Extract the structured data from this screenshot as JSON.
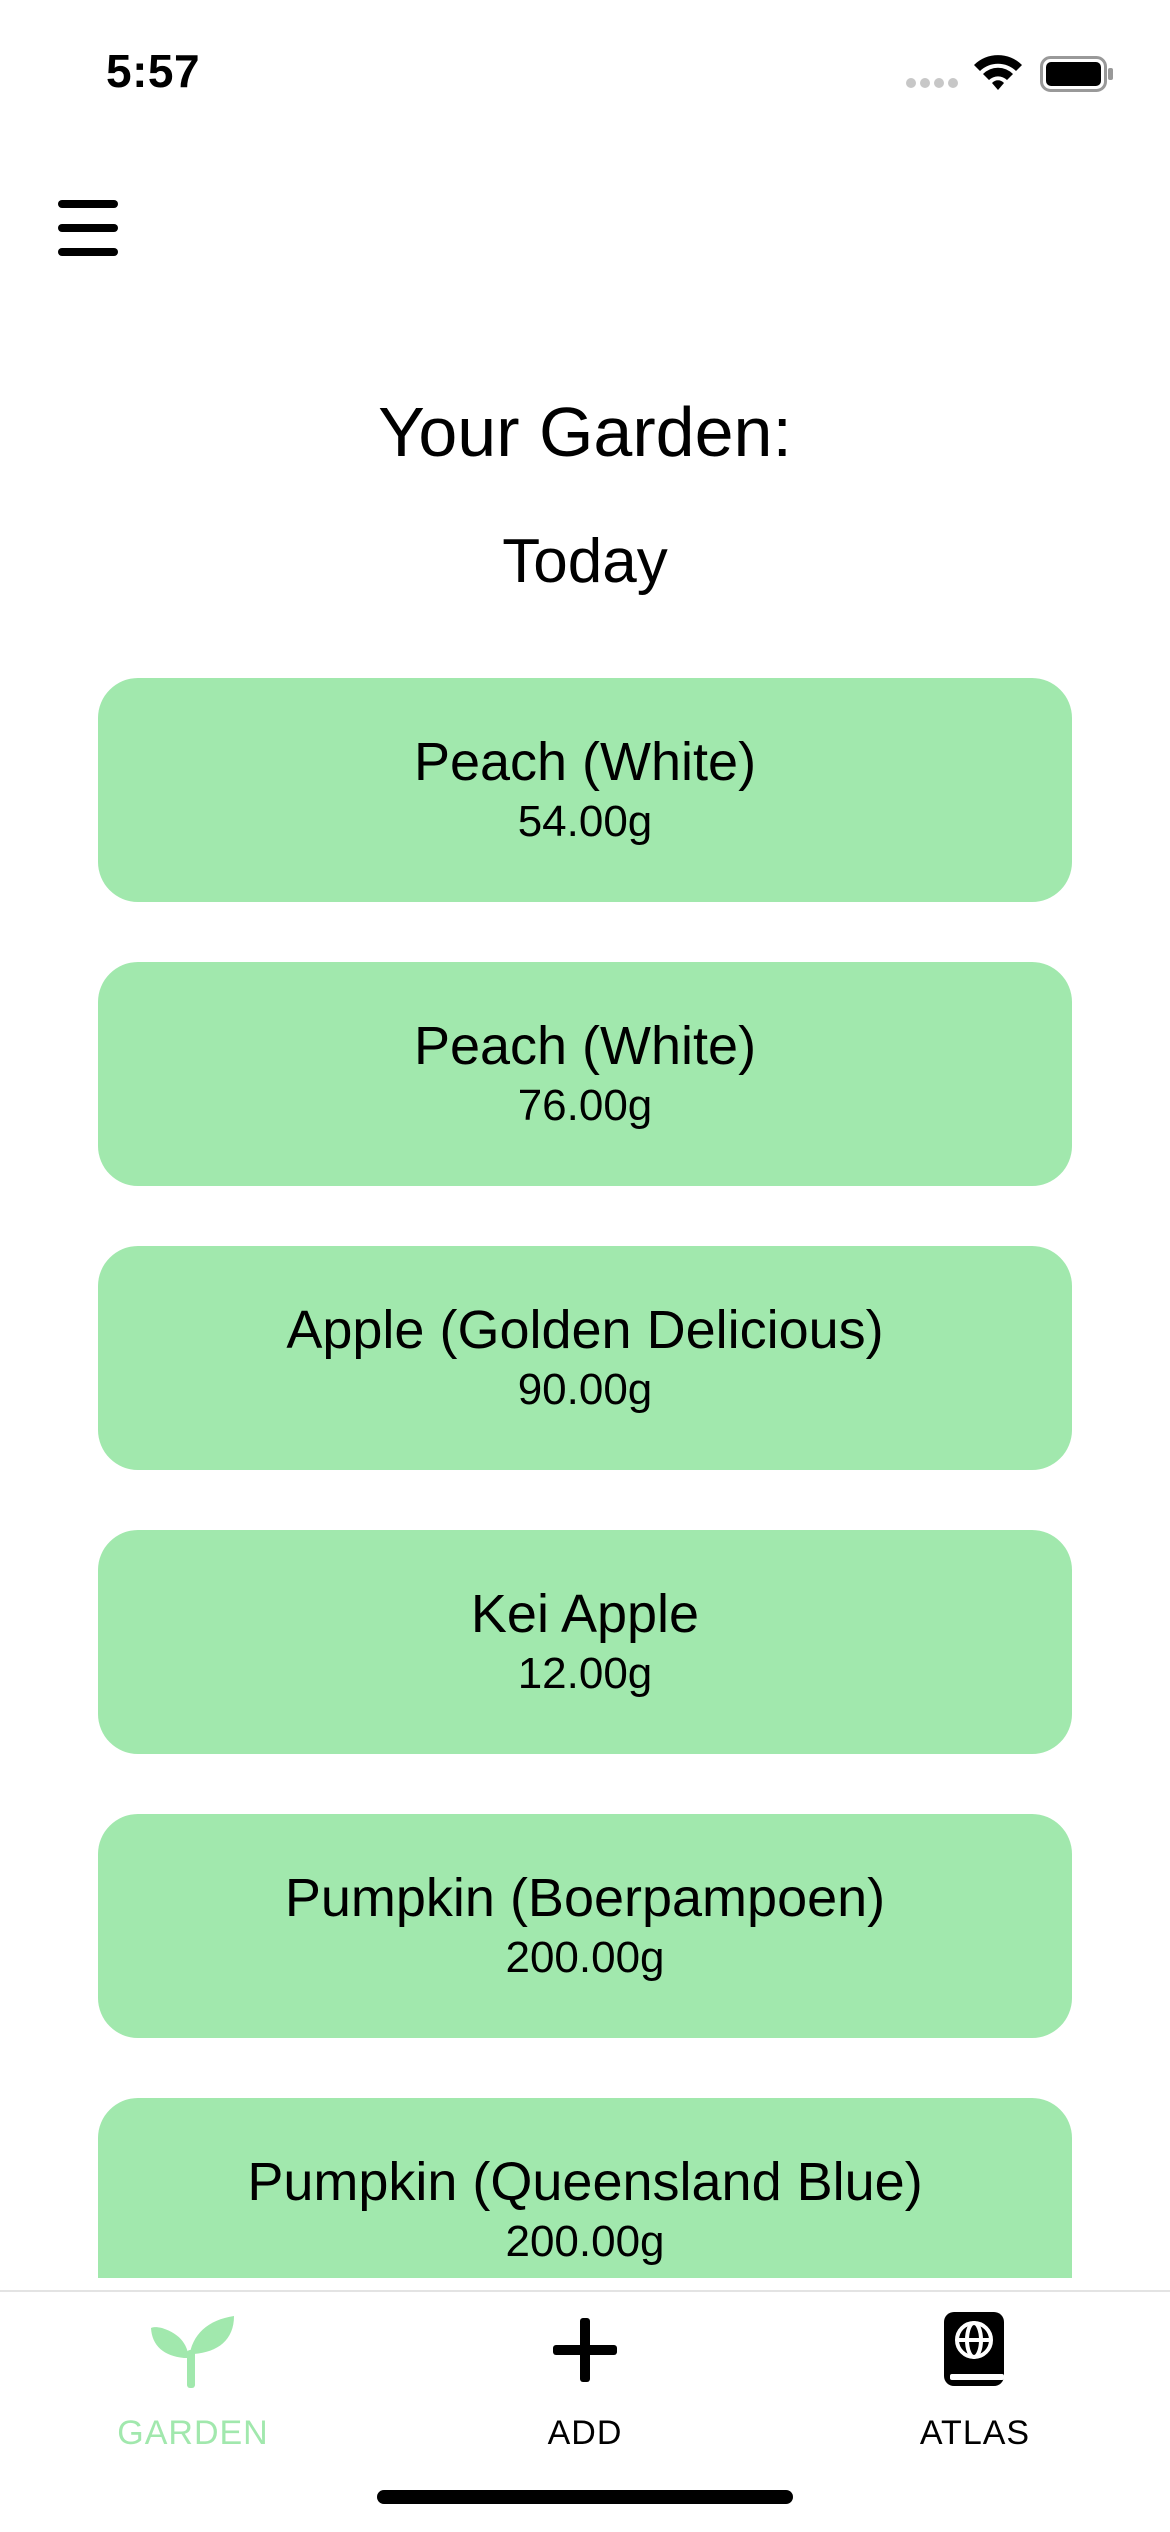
{
  "status_bar": {
    "time": "5:57",
    "signal_icon": "cellular-signal-icon",
    "wifi_icon": "wifi-icon",
    "battery_icon": "battery-icon"
  },
  "header": {
    "menu_icon": "hamburger-menu-icon",
    "title": "Your Garden:",
    "section": "Today"
  },
  "plants": [
    {
      "name": "Peach (White)",
      "weight": "54.00g"
    },
    {
      "name": "Peach (White)",
      "weight": "76.00g"
    },
    {
      "name": "Apple (Golden Delicious)",
      "weight": "90.00g"
    },
    {
      "name": "Kei Apple",
      "weight": "12.00g"
    },
    {
      "name": "Pumpkin (Boerpampoen)",
      "weight": "200.00g"
    },
    {
      "name": "Pumpkin (Queensland Blue)",
      "weight": "200.00g"
    }
  ],
  "tab_bar": {
    "tabs": [
      {
        "label": "GARDEN",
        "icon": "sprout-icon",
        "active": true
      },
      {
        "label": "ADD",
        "icon": "plus-icon",
        "active": false
      },
      {
        "label": "ATLAS",
        "icon": "globe-book-icon",
        "active": false
      }
    ]
  },
  "colors": {
    "card_background": "#a1e8ad",
    "active_tab": "#a1e8ad",
    "inactive_tab": "#000000",
    "background": "#ffffff"
  }
}
